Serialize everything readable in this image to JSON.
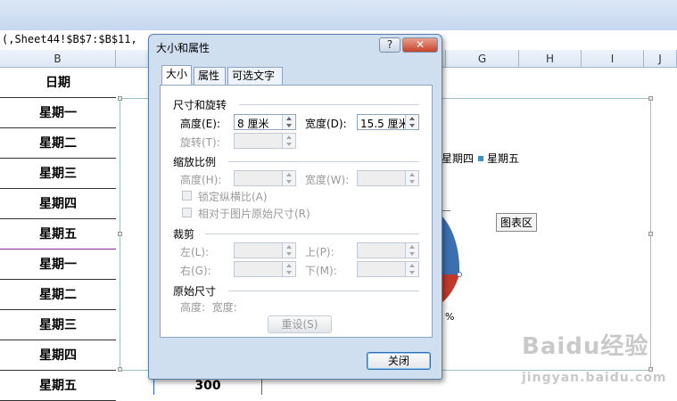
{
  "formula_bar": {
    "text": "(,Sheet44!$B$7:$B$11,"
  },
  "column_headers": [
    "B",
    "G",
    "H",
    "I",
    "J"
  ],
  "sheet_rows": [
    "日期",
    "星期一",
    "星期二",
    "星期三",
    "星期四",
    "星期五",
    "星期一",
    "星期二",
    "星期三",
    "星期四",
    "星期五"
  ],
  "bottom_cell_value": "300",
  "chart": {
    "legend": [
      "星期四",
      "星期五"
    ],
    "area_tooltip": "图表区",
    "pct_label": "%",
    "colors": {
      "series_blue": "#3a8fc4",
      "pie_red": "#c0392b",
      "pie_blue": "#3b6fb0"
    }
  },
  "dialog": {
    "title": "大小和属性",
    "help_button": "?",
    "close_x": "✕",
    "tabs": [
      "大小",
      "属性",
      "可选文字"
    ],
    "sections": {
      "size_rotate": "尺寸和旋转",
      "scale": "缩放比例",
      "crop": "裁剪",
      "original": "原始尺寸"
    },
    "fields": {
      "height_label": "高度(E):",
      "height_value": "8 厘米",
      "width_label": "宽度(D):",
      "width_value": "15.5 厘米",
      "rotate_label": "旋转(T):",
      "scale_height_label": "高度(H):",
      "scale_width_label": "宽度(W):",
      "lock_ratio": "锁定纵横比(A)",
      "relative_original": "相对于图片原始尺寸(R)",
      "crop_left": "左(L):",
      "crop_top": "上(P):",
      "crop_right": "右(G):",
      "crop_bottom": "下(M):",
      "original_size": "高度:  宽度:"
    },
    "reset_button": "重设(S)",
    "close_button": "关闭"
  },
  "watermark": {
    "text": "Baidu经验",
    "sub": "jingyan.baidu.com"
  }
}
